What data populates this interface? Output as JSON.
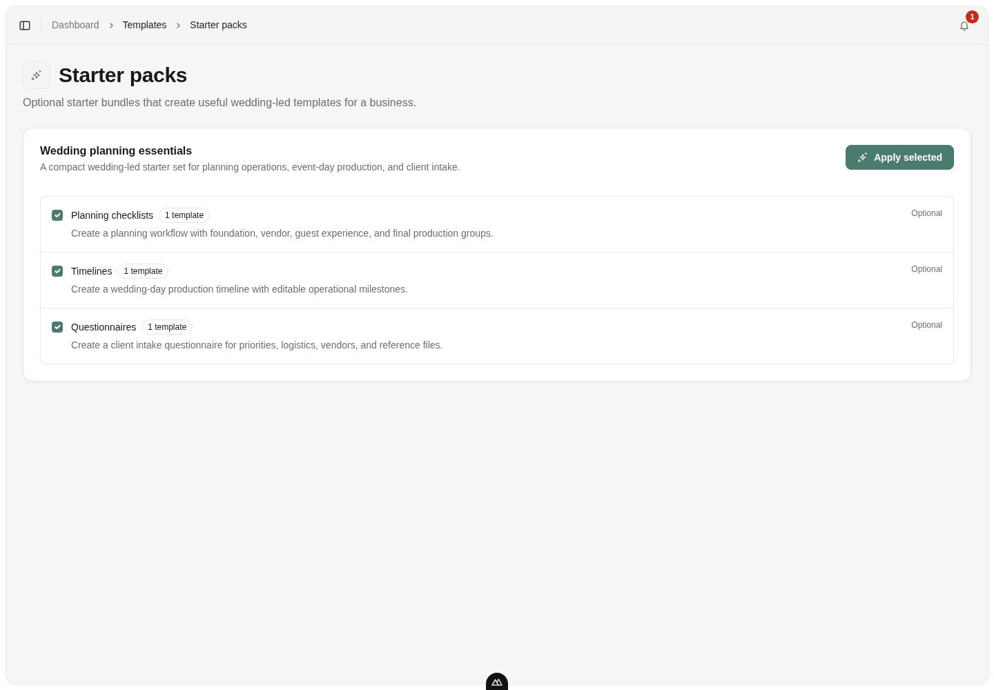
{
  "header": {
    "breadcrumbs": [
      {
        "label": "Dashboard",
        "muted": true
      },
      {
        "label": "Templates",
        "muted": false
      },
      {
        "label": "Starter packs",
        "muted": false
      }
    ],
    "notification_count": "1"
  },
  "page": {
    "title": "Starter packs",
    "subtitle": "Optional starter bundles that create useful wedding-led templates for a business."
  },
  "pack": {
    "title": "Wedding planning essentials",
    "description": "A compact wedding-led starter set for planning operations, event-day production, and client intake.",
    "action": "Apply selected",
    "items": [
      {
        "name": "Planning checklists",
        "badge": "1 template",
        "description": "Create a planning workflow with foundation, vendor, guest experience, and final production groups.",
        "tag": "Optional",
        "checked": true
      },
      {
        "name": "Timelines",
        "badge": "1 template",
        "description": "Create a wedding-day production timeline with editable operational milestones.",
        "tag": "Optional",
        "checked": true
      },
      {
        "name": "Questionnaires",
        "badge": "1 template",
        "description": "Create a client intake questionnaire for priorities, logistics, vendors, and reference files.",
        "tag": "Optional",
        "checked": true
      }
    ]
  }
}
